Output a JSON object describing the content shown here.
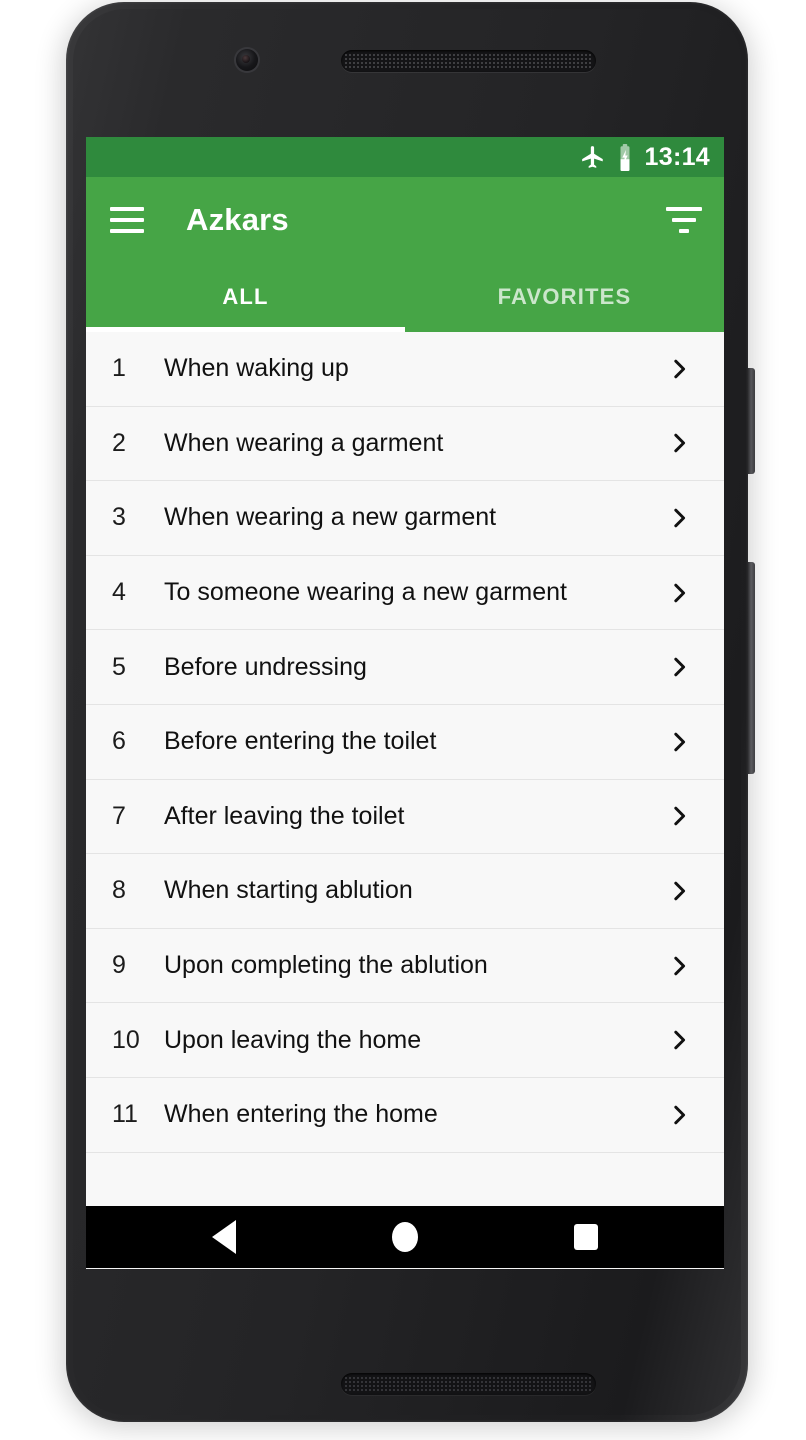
{
  "status_bar": {
    "airplane_icon": "airplane-mode-icon",
    "battery_icon": "battery-charging-icon",
    "time": "13:14"
  },
  "app_bar": {
    "menu_icon": "hamburger-menu-icon",
    "title": "Azkars",
    "filter_icon": "filter-icon"
  },
  "tabs": [
    {
      "label": "ALL",
      "active": true
    },
    {
      "label": "FAVORITES",
      "active": false
    }
  ],
  "list": {
    "items": [
      {
        "num": "1",
        "label": "When waking up"
      },
      {
        "num": "2",
        "label": "When wearing a garment"
      },
      {
        "num": "3",
        "label": "When wearing a new garment"
      },
      {
        "num": "4",
        "label": "To someone wearing a new garment"
      },
      {
        "num": "5",
        "label": "Before undressing"
      },
      {
        "num": "6",
        "label": "Before entering the toilet"
      },
      {
        "num": "7",
        "label": "After leaving the toilet"
      },
      {
        "num": "8",
        "label": "When starting ablution"
      },
      {
        "num": "9",
        "label": "Upon completing the ablution"
      },
      {
        "num": "10",
        "label": "Upon leaving the home"
      },
      {
        "num": "11",
        "label": "When entering the home"
      },
      {
        "num": "",
        "label": ""
      }
    ],
    "chevron_icon": "chevron-right-icon"
  },
  "nav_bar": {
    "back": "back-button",
    "home": "home-button",
    "recents": "recents-button"
  },
  "colors": {
    "status_bar_green": "#2f8a3d",
    "app_bar_green": "#46a546",
    "list_bg": "#f8f8f8",
    "divider": "#e4e4e4",
    "nav_bg": "#000000"
  }
}
